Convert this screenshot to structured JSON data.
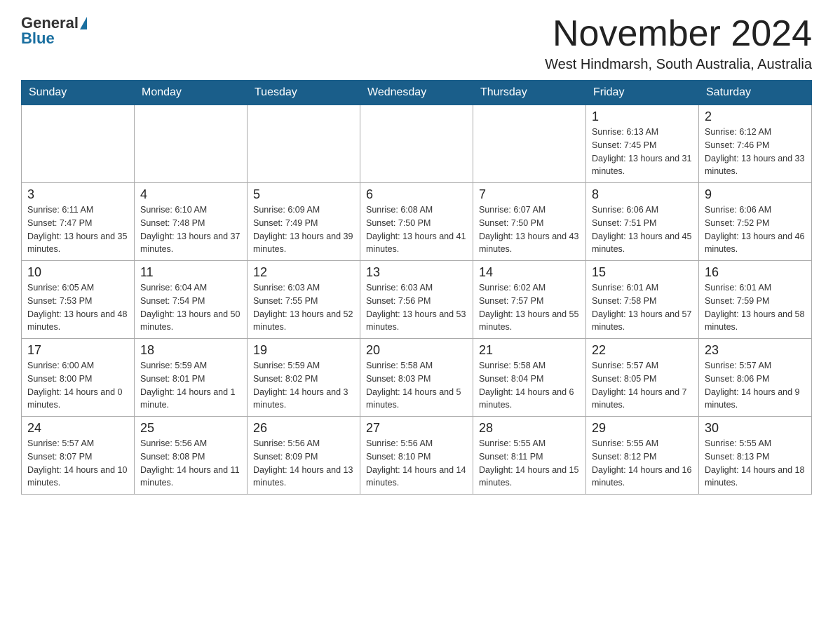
{
  "header": {
    "logo_general": "General",
    "logo_blue": "Blue",
    "month_title": "November 2024",
    "subtitle": "West Hindmarsh, South Australia, Australia"
  },
  "days_of_week": [
    "Sunday",
    "Monday",
    "Tuesday",
    "Wednesday",
    "Thursday",
    "Friday",
    "Saturday"
  ],
  "weeks": [
    [
      {
        "day": "",
        "info": ""
      },
      {
        "day": "",
        "info": ""
      },
      {
        "day": "",
        "info": ""
      },
      {
        "day": "",
        "info": ""
      },
      {
        "day": "",
        "info": ""
      },
      {
        "day": "1",
        "info": "Sunrise: 6:13 AM\nSunset: 7:45 PM\nDaylight: 13 hours and 31 minutes."
      },
      {
        "day": "2",
        "info": "Sunrise: 6:12 AM\nSunset: 7:46 PM\nDaylight: 13 hours and 33 minutes."
      }
    ],
    [
      {
        "day": "3",
        "info": "Sunrise: 6:11 AM\nSunset: 7:47 PM\nDaylight: 13 hours and 35 minutes."
      },
      {
        "day": "4",
        "info": "Sunrise: 6:10 AM\nSunset: 7:48 PM\nDaylight: 13 hours and 37 minutes."
      },
      {
        "day": "5",
        "info": "Sunrise: 6:09 AM\nSunset: 7:49 PM\nDaylight: 13 hours and 39 minutes."
      },
      {
        "day": "6",
        "info": "Sunrise: 6:08 AM\nSunset: 7:50 PM\nDaylight: 13 hours and 41 minutes."
      },
      {
        "day": "7",
        "info": "Sunrise: 6:07 AM\nSunset: 7:50 PM\nDaylight: 13 hours and 43 minutes."
      },
      {
        "day": "8",
        "info": "Sunrise: 6:06 AM\nSunset: 7:51 PM\nDaylight: 13 hours and 45 minutes."
      },
      {
        "day": "9",
        "info": "Sunrise: 6:06 AM\nSunset: 7:52 PM\nDaylight: 13 hours and 46 minutes."
      }
    ],
    [
      {
        "day": "10",
        "info": "Sunrise: 6:05 AM\nSunset: 7:53 PM\nDaylight: 13 hours and 48 minutes."
      },
      {
        "day": "11",
        "info": "Sunrise: 6:04 AM\nSunset: 7:54 PM\nDaylight: 13 hours and 50 minutes."
      },
      {
        "day": "12",
        "info": "Sunrise: 6:03 AM\nSunset: 7:55 PM\nDaylight: 13 hours and 52 minutes."
      },
      {
        "day": "13",
        "info": "Sunrise: 6:03 AM\nSunset: 7:56 PM\nDaylight: 13 hours and 53 minutes."
      },
      {
        "day": "14",
        "info": "Sunrise: 6:02 AM\nSunset: 7:57 PM\nDaylight: 13 hours and 55 minutes."
      },
      {
        "day": "15",
        "info": "Sunrise: 6:01 AM\nSunset: 7:58 PM\nDaylight: 13 hours and 57 minutes."
      },
      {
        "day": "16",
        "info": "Sunrise: 6:01 AM\nSunset: 7:59 PM\nDaylight: 13 hours and 58 minutes."
      }
    ],
    [
      {
        "day": "17",
        "info": "Sunrise: 6:00 AM\nSunset: 8:00 PM\nDaylight: 14 hours and 0 minutes."
      },
      {
        "day": "18",
        "info": "Sunrise: 5:59 AM\nSunset: 8:01 PM\nDaylight: 14 hours and 1 minute."
      },
      {
        "day": "19",
        "info": "Sunrise: 5:59 AM\nSunset: 8:02 PM\nDaylight: 14 hours and 3 minutes."
      },
      {
        "day": "20",
        "info": "Sunrise: 5:58 AM\nSunset: 8:03 PM\nDaylight: 14 hours and 5 minutes."
      },
      {
        "day": "21",
        "info": "Sunrise: 5:58 AM\nSunset: 8:04 PM\nDaylight: 14 hours and 6 minutes."
      },
      {
        "day": "22",
        "info": "Sunrise: 5:57 AM\nSunset: 8:05 PM\nDaylight: 14 hours and 7 minutes."
      },
      {
        "day": "23",
        "info": "Sunrise: 5:57 AM\nSunset: 8:06 PM\nDaylight: 14 hours and 9 minutes."
      }
    ],
    [
      {
        "day": "24",
        "info": "Sunrise: 5:57 AM\nSunset: 8:07 PM\nDaylight: 14 hours and 10 minutes."
      },
      {
        "day": "25",
        "info": "Sunrise: 5:56 AM\nSunset: 8:08 PM\nDaylight: 14 hours and 11 minutes."
      },
      {
        "day": "26",
        "info": "Sunrise: 5:56 AM\nSunset: 8:09 PM\nDaylight: 14 hours and 13 minutes."
      },
      {
        "day": "27",
        "info": "Sunrise: 5:56 AM\nSunset: 8:10 PM\nDaylight: 14 hours and 14 minutes."
      },
      {
        "day": "28",
        "info": "Sunrise: 5:55 AM\nSunset: 8:11 PM\nDaylight: 14 hours and 15 minutes."
      },
      {
        "day": "29",
        "info": "Sunrise: 5:55 AM\nSunset: 8:12 PM\nDaylight: 14 hours and 16 minutes."
      },
      {
        "day": "30",
        "info": "Sunrise: 5:55 AM\nSunset: 8:13 PM\nDaylight: 14 hours and 18 minutes."
      }
    ]
  ]
}
